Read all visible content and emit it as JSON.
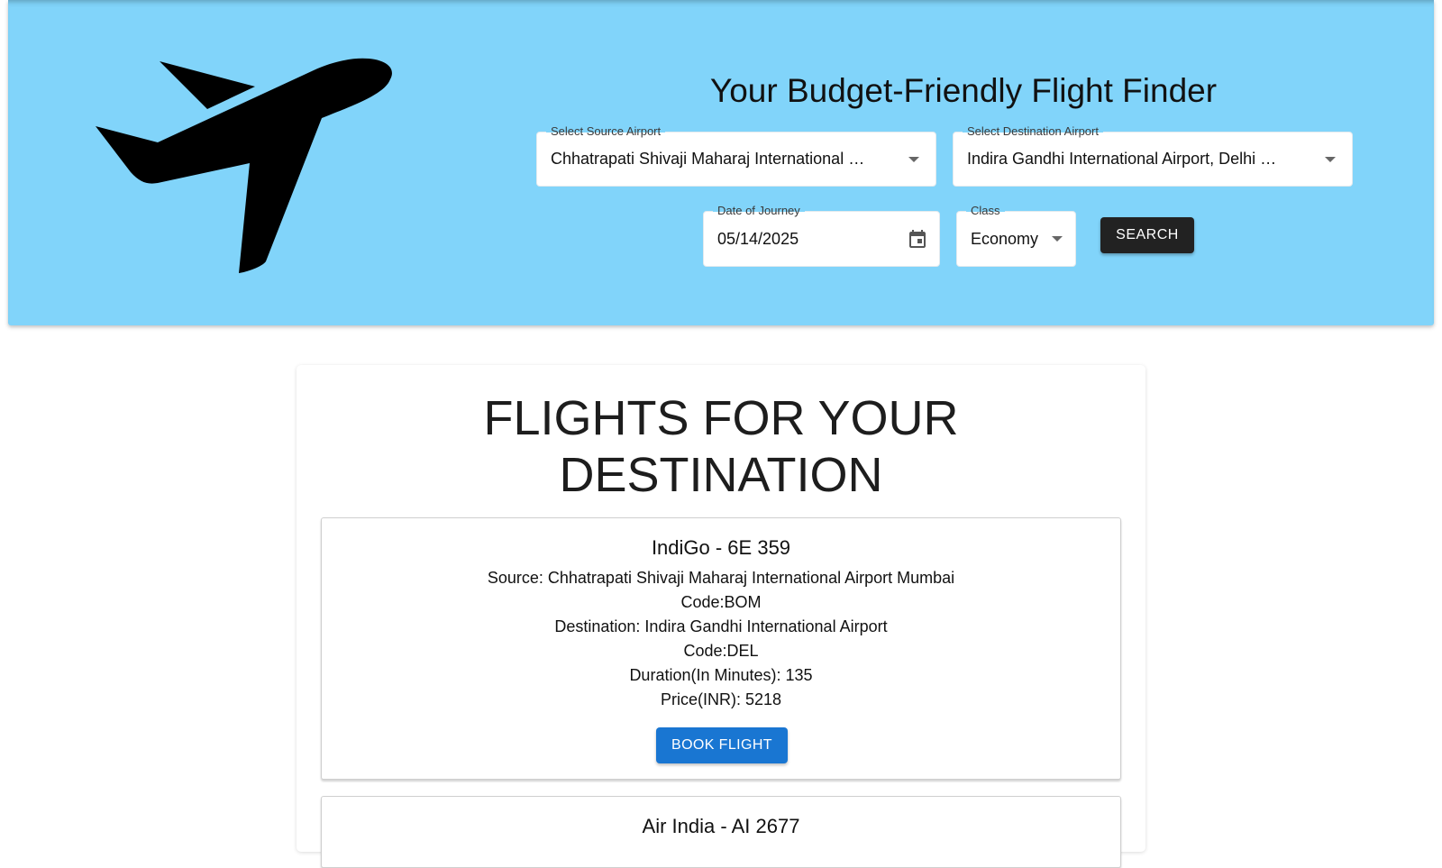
{
  "header": {
    "title": "Your Budget-Friendly Flight Finder",
    "logo_icon": "airplane-icon",
    "background_color": "#81d4fa"
  },
  "search": {
    "source": {
      "label": "Select Source Airport",
      "value": "Chhatrapati Shivaji Maharaj International …"
    },
    "destination": {
      "label": "Select Destination Airport",
      "value": "Indira Gandhi International Airport, Delhi …"
    },
    "date": {
      "label": "Date of Journey",
      "value": "05/14/2025",
      "icon": "calendar-icon"
    },
    "travel_class": {
      "label": "Class",
      "value": "Economy"
    },
    "search_button": "SEARCH"
  },
  "results": {
    "title_line1": "FLIGHTS FOR YOUR",
    "title_line2": "DESTINATION",
    "flights": [
      {
        "name": "IndiGo - 6E 359",
        "source": "Source: Chhatrapati Shivaji Maharaj International Airport Mumbai",
        "source_code": "Code:BOM",
        "destination": "Destination: Indira Gandhi International Airport",
        "destination_code": "Code:DEL",
        "duration": "Duration(In Minutes): 135",
        "price": "Price(INR): 5218",
        "book_button": "BOOK FLIGHT"
      },
      {
        "name": "Air India - AI 2677"
      }
    ]
  },
  "colors": {
    "accent": "#1976d2",
    "search_button": "#222222"
  }
}
